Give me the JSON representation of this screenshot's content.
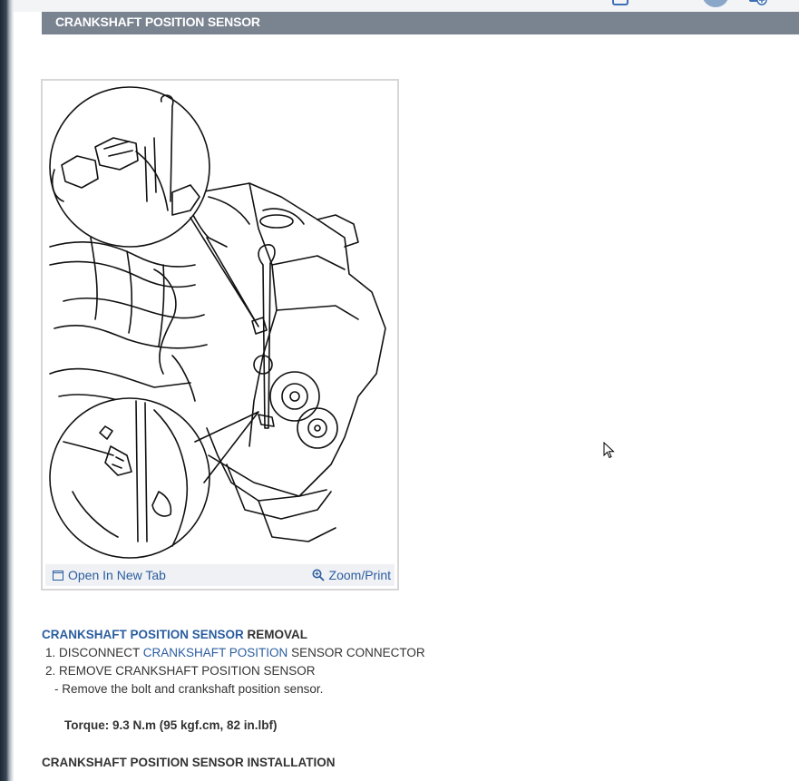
{
  "header": {
    "title": "CRANKSHAFT POSITION SENSOR"
  },
  "figure": {
    "open_tab_label": "Open In New Tab",
    "zoom_label": "Zoom/Print"
  },
  "instructions": {
    "removal_heading_link": "CRANKSHAFT POSITION SENSOR",
    "removal_heading_rest": " REMOVAL",
    "step1_prefix": "1. DISCONNECT ",
    "step1_link": "CRANKSHAFT POSITION",
    "step1_suffix": " SENSOR CONNECTOR",
    "step2": "2. REMOVE CRANKSHAFT POSITION SENSOR",
    "substep": "-  Remove the bolt and crankshaft position sensor.",
    "torque": "Torque: 9.3 N.m (95 kgf.cm, 82 in.lbf)",
    "installation_heading": "CRANKSHAFT POSITION SENSOR INSTALLATION"
  },
  "colors": {
    "header_bg": "#7a8390",
    "link": "#2a5d9f"
  }
}
